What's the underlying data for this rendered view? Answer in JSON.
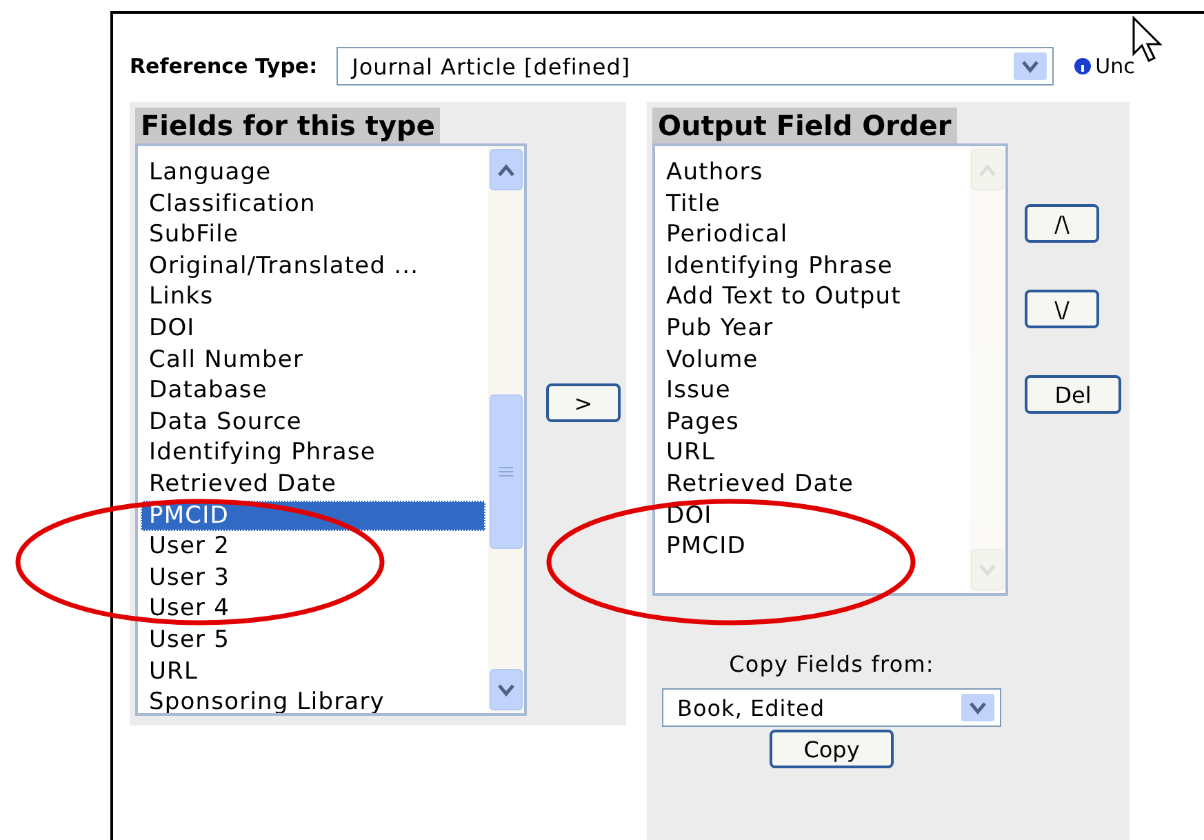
{
  "reference_type": {
    "label": "Reference Type:",
    "value": "Journal Article [defined]",
    "info": "Unc"
  },
  "fields_panel": {
    "title": "Fields for this type",
    "items": [
      {
        "label": "Language",
        "selected": false
      },
      {
        "label": "Classification",
        "selected": false
      },
      {
        "label": "SubFile",
        "selected": false
      },
      {
        "label": "Original/Translated ...",
        "selected": false
      },
      {
        "label": "Links",
        "selected": false
      },
      {
        "label": "DOI",
        "selected": false
      },
      {
        "label": "Call Number",
        "selected": false
      },
      {
        "label": "Database",
        "selected": false
      },
      {
        "label": "Data Source",
        "selected": false
      },
      {
        "label": "Identifying Phrase",
        "selected": false
      },
      {
        "label": "Retrieved Date",
        "selected": false
      },
      {
        "label": "PMCID",
        "selected": true
      },
      {
        "label": "User 2",
        "selected": false
      },
      {
        "label": "User 3",
        "selected": false
      },
      {
        "label": "User 4",
        "selected": false
      },
      {
        "label": "User 5",
        "selected": false
      },
      {
        "label": "URL",
        "selected": false
      },
      {
        "label": "Sponsoring Library",
        "selected": false
      }
    ]
  },
  "add_button": ">",
  "output_panel": {
    "title": "Output Field Order",
    "items": [
      {
        "label": "Authors",
        "selected": false
      },
      {
        "label": "Title",
        "selected": false
      },
      {
        "label": "Periodical",
        "selected": false
      },
      {
        "label": "Identifying Phrase",
        "selected": false
      },
      {
        "label": "Add Text to Output",
        "selected": false
      },
      {
        "label": "Pub Year",
        "selected": false
      },
      {
        "label": "Volume",
        "selected": false
      },
      {
        "label": "Issue",
        "selected": false
      },
      {
        "label": "Pages",
        "selected": false
      },
      {
        "label": "URL",
        "selected": false
      },
      {
        "label": "Retrieved Date",
        "selected": false
      },
      {
        "label": "DOI",
        "selected": false
      },
      {
        "label": "PMCID",
        "selected": false
      }
    ]
  },
  "order_buttons": [
    "/\\",
    "\\/",
    "Del"
  ],
  "copy_fields": {
    "label": "Copy Fields from:",
    "value": "Book, Edited",
    "button": "Copy"
  }
}
